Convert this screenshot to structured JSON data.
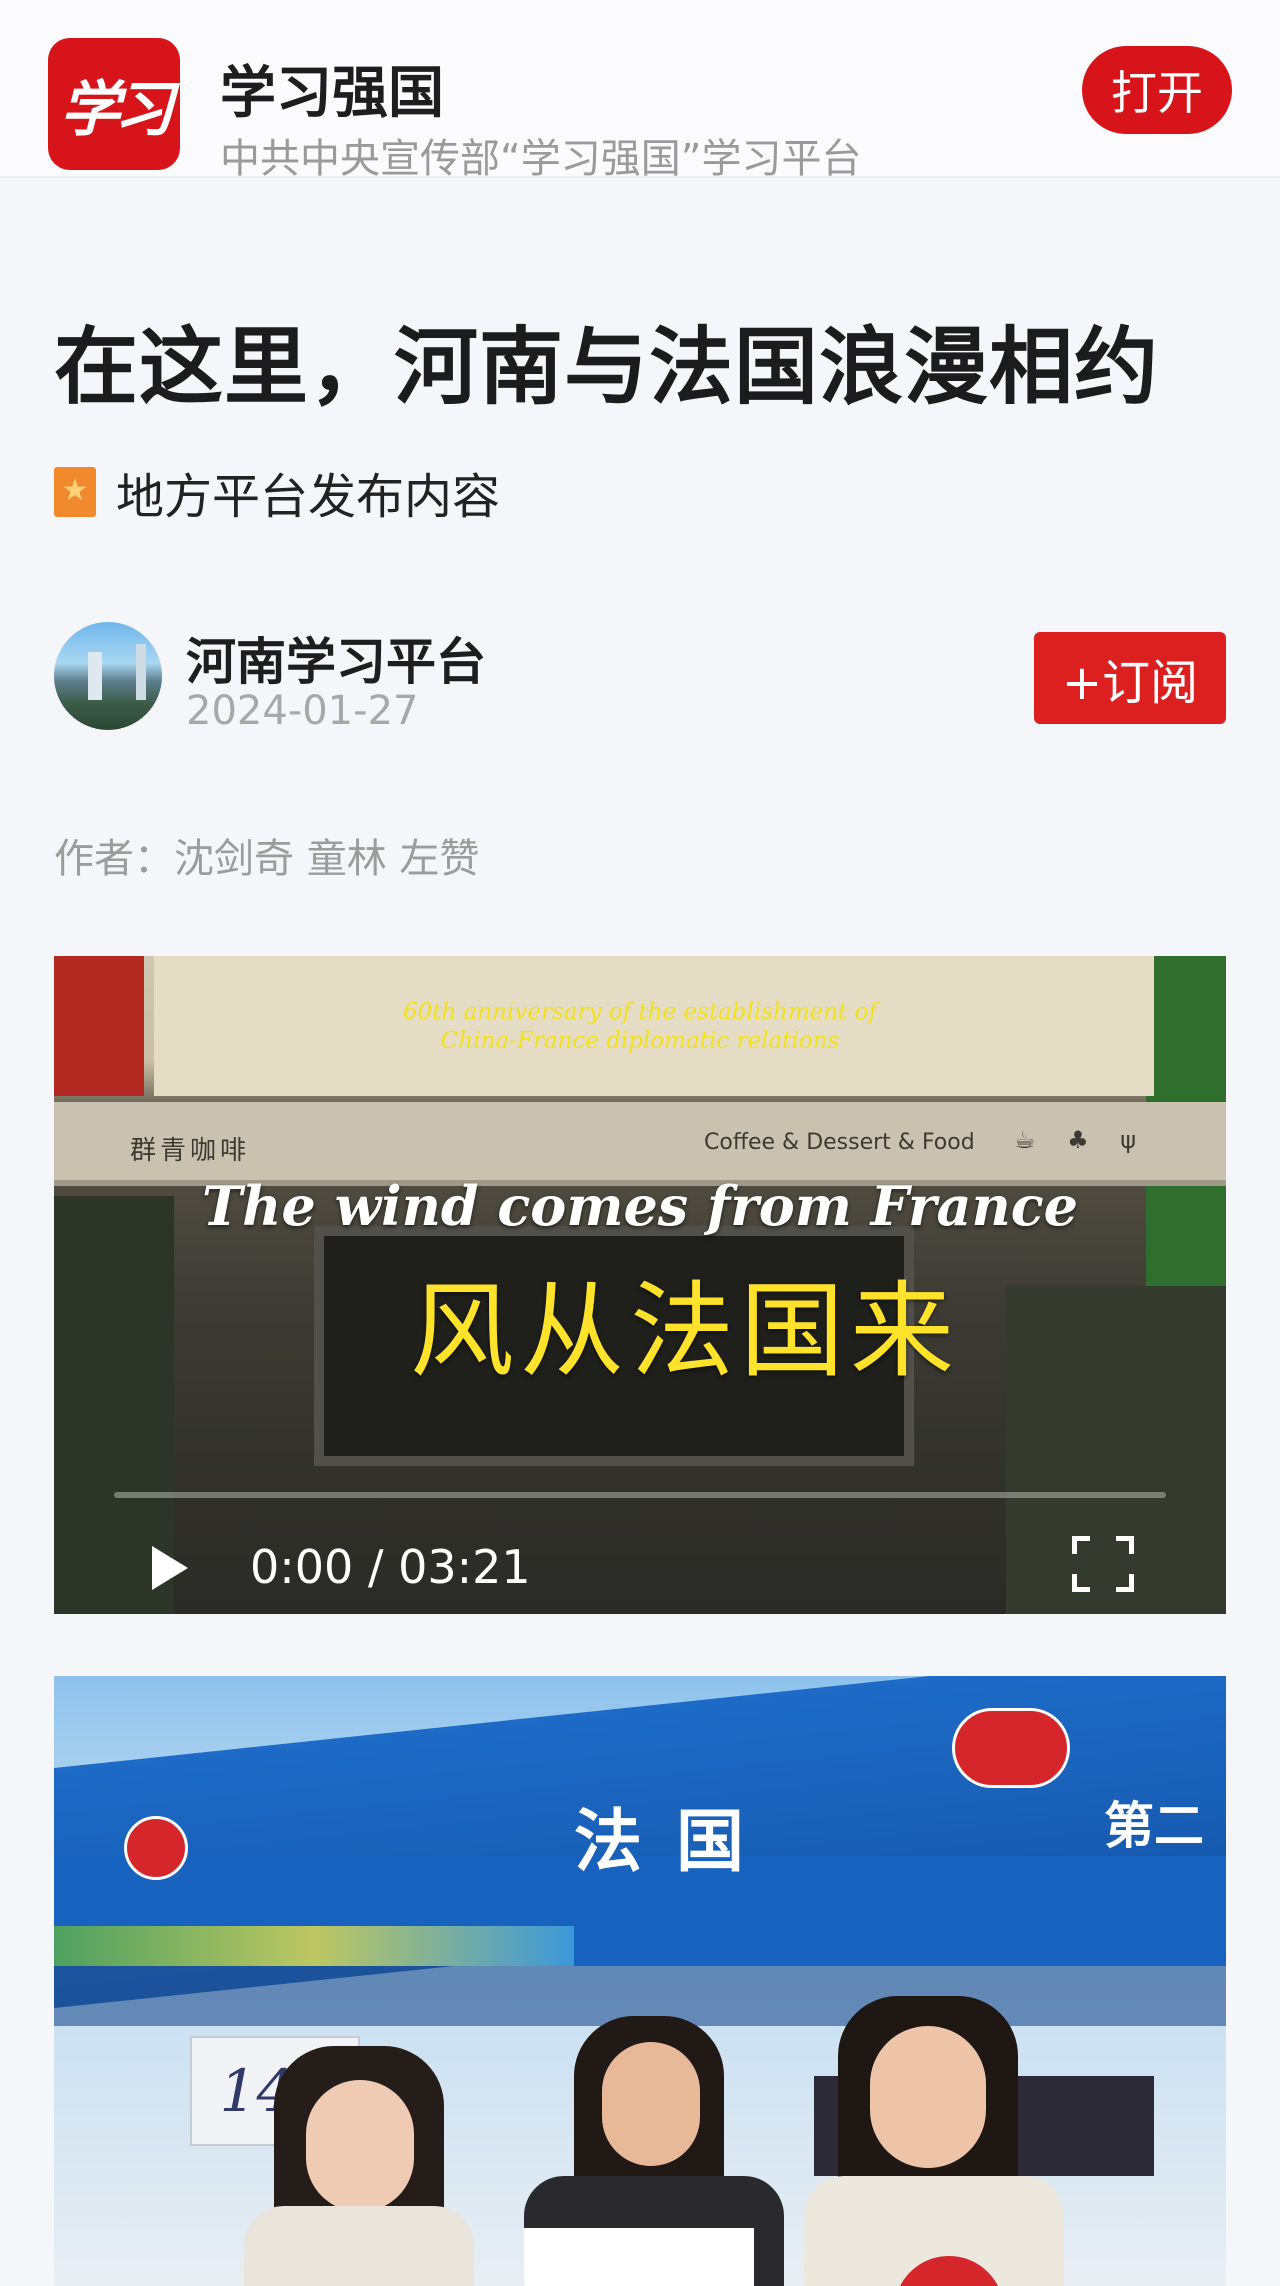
{
  "app_banner": {
    "logo_text": "学习",
    "app_name": "学习强国",
    "description": "中共中央宣传部“学习强国”学习平台",
    "open_label": "打开"
  },
  "article": {
    "title": "在这里，河南与法国浪漫相约",
    "source_label": "地方平台发布内容",
    "author_channel": "河南学习平台",
    "date": "2024-01-27",
    "subscribe_label": "+订阅",
    "byline": "作者：沈剑奇 童林 左赞"
  },
  "video": {
    "anniversary_line1": "60th anniversary of the establishment of",
    "anniversary_line2": "China-France diplomatic relations",
    "awning_left": "群青咖啡",
    "awning_right": "Coffee & Dessert & Food",
    "cup_icons": "☕ ♣ ψ",
    "title_en": "The wind comes from France",
    "title_zh": "风从法国来",
    "current_time": "0:00",
    "separator": "/",
    "duration": "03:21",
    "progress": 0.0,
    "icons": [
      "play-icon",
      "fullscreen-icon"
    ]
  },
  "photo": {
    "tent_label": "法国",
    "tent_label_right": "第二",
    "banner_140": "140"
  },
  "colors": {
    "brand_red": "#d7141a",
    "subscribe_red": "#dc1f1f",
    "video_title_yellow": "#ffe32a"
  }
}
